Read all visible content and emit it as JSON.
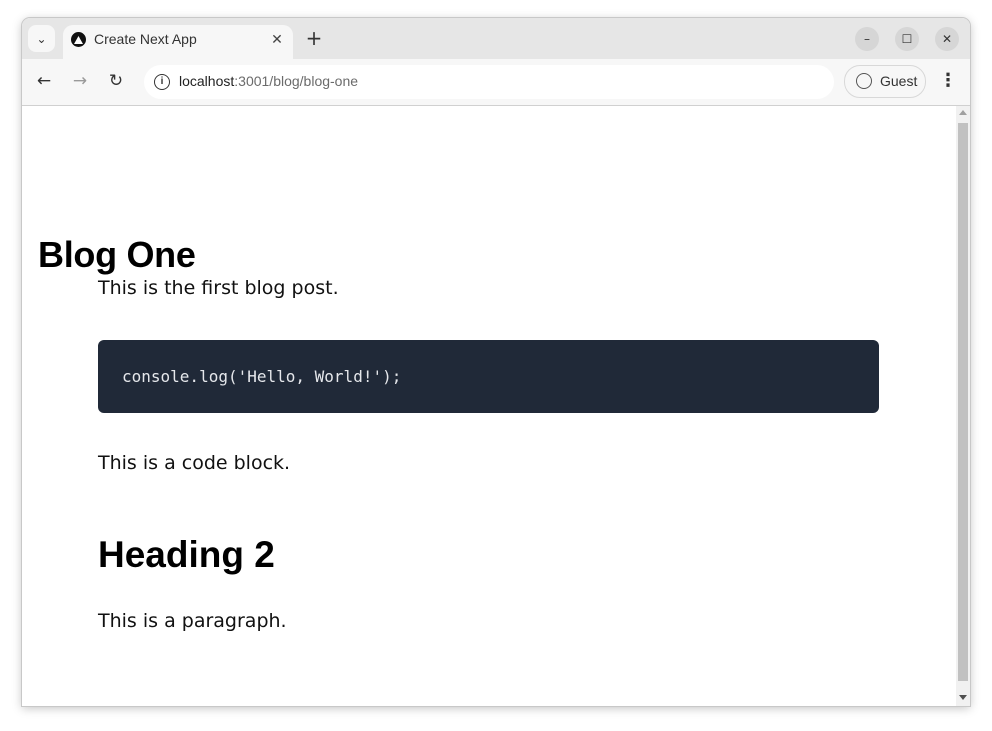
{
  "browser": {
    "tab": {
      "title": "Create Next App",
      "favicon": "nextjs-logo-icon",
      "close_glyph": "✕"
    },
    "new_tab_glyph": "+",
    "tab_search_glyph": "⌄",
    "window_controls": {
      "minimize": "–",
      "maximize": "☐",
      "close": "✕"
    },
    "nav": {
      "back": "←",
      "forward": "→",
      "reload": "↻"
    },
    "url": {
      "host": "localhost",
      "rest": ":3001/blog/blog-one"
    },
    "site_info_glyph": "i",
    "profile": {
      "label": "Guest"
    },
    "menu_glyph": "⋮"
  },
  "page": {
    "title": "Blog One",
    "intro": "This is the first blog post.",
    "code": "console.log('Hello, World!');",
    "after_code": "This is a code block.",
    "heading2": "Heading 2",
    "paragraph": "This is a paragraph."
  }
}
